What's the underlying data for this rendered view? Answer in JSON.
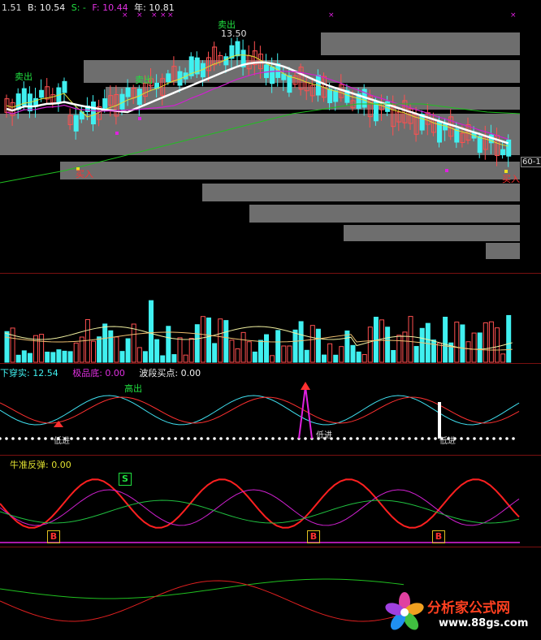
{
  "header": {
    "b1": "1.51",
    "b": "B: 10.54",
    "s": "S: -",
    "f": "F: 10.44",
    "year": "年: 10.81"
  },
  "price_labels": {
    "sell1": "卖出",
    "sell2": "卖出",
    "high_price": "13.50",
    "buy1": "买入",
    "buy2": "买入",
    "right_tag": "60-1"
  },
  "indicator1": {
    "cross": "下穿实: 12.54",
    "bottom": "极品底: 0.00",
    "wave": "波段买点: 0.00",
    "high_out": "高出",
    "buy_in1": "低进",
    "buy_in2": "低进",
    "buy_in3": "低进"
  },
  "indicator2": {
    "title": "牛准反弹: 0.00",
    "s_mark": "S",
    "b_mark1": "B",
    "b_mark2": "B",
    "b_mark3": "B"
  },
  "watermark": {
    "name": "分析家公式网",
    "url": "www.88gs.com"
  },
  "colors": {
    "up": "#ff5050",
    "down": "#40f0f0",
    "ma_white": "#ffffff",
    "ma_yellow": "#e0e030",
    "ma_magenta": "#d020d0",
    "ma_green": "#20c020",
    "divider": "#7a1010"
  }
}
